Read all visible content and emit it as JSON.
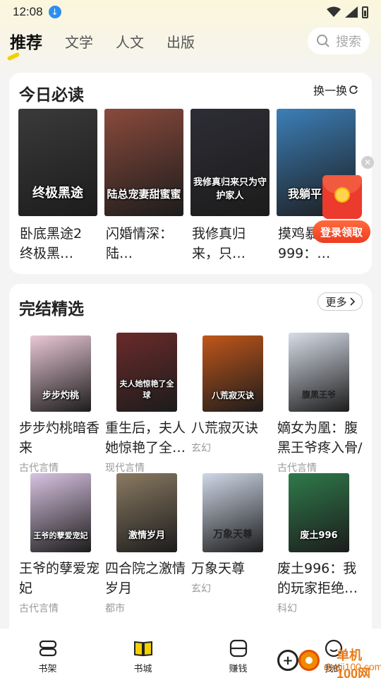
{
  "status_bar": {
    "time": "12:08"
  },
  "top_tabs": [
    {
      "label": "推荐",
      "active": true
    },
    {
      "label": "文学",
      "active": false
    },
    {
      "label": "人文",
      "active": false
    },
    {
      "label": "出版",
      "active": false
    }
  ],
  "search": {
    "placeholder": "搜索"
  },
  "daily": {
    "title": "今日必读",
    "refresh_label": "换一换",
    "books": [
      {
        "name": "卧底黑途2终极黑…",
        "cover_text": "终极黑途",
        "cover_color": "#3a3a3a"
      },
      {
        "name": "闪婚情深：陆…",
        "cover_text": "陆总宠妻甜蜜蜜",
        "cover_color": "#8a4a3c"
      },
      {
        "name": "我修真归来，只…",
        "cover_text": "我修真归来只为守护家人",
        "cover_color": "#2d2d35"
      },
      {
        "name": "摸鸡暴…999：…",
        "cover_text": "我躺平了仙",
        "cover_color": "#3c7fb8"
      }
    ]
  },
  "finished": {
    "title": "完结精选",
    "more_label": "更多",
    "books": [
      {
        "name": "步步灼桃暗香来",
        "genre": "古代言情",
        "cover_text": "步步灼桃",
        "cover_color": "#e9c8d6"
      },
      {
        "name": "重生后，夫人她惊艳了全…",
        "genre": "现代言情",
        "cover_text": "夫人她惊艳了全球",
        "cover_color": "#6b2a2a"
      },
      {
        "name": "八荒寂灭诀",
        "genre": "玄幻",
        "cover_text": "八荒寂灭诀",
        "cover_color": "#c0561a"
      },
      {
        "name": "嫡女为凰：腹黑王爷疼入骨/",
        "genre": "古代言情",
        "cover_text": "腹黑王爷",
        "cover_color": "#d8dde8"
      },
      {
        "name": "王爷的孽爱宠妃",
        "genre": "古代言情",
        "cover_text": "王爷的孽爱宠妃",
        "cover_color": "#d9c3e2"
      },
      {
        "name": "四合院之激情岁月",
        "genre": "都市",
        "cover_text": "激情岁月",
        "cover_color": "#8a7a62"
      },
      {
        "name": "万象天尊",
        "genre": "玄幻",
        "cover_text": "万象天尊",
        "cover_color": "#cfd8e8"
      },
      {
        "name": "废土996：我的玩家拒绝…",
        "genre": "科幻",
        "cover_text": "废土996",
        "cover_color": "#2f7a4a"
      }
    ]
  },
  "floating": {
    "button_label": "登录领取"
  },
  "bottom_nav": [
    {
      "label": "书架",
      "icon": "bookshelf-icon"
    },
    {
      "label": "书城",
      "icon": "bookstore-icon"
    },
    {
      "label": "赚钱",
      "icon": "wallet-icon"
    },
    {
      "label": "我的",
      "icon": "profile-icon"
    }
  ],
  "watermark": {
    "line1": "单机100网",
    "line2": "danji100.com"
  },
  "colors": {
    "accent": "#f5d000",
    "red": "#ec3a2c",
    "watermark": "#e87a17"
  }
}
